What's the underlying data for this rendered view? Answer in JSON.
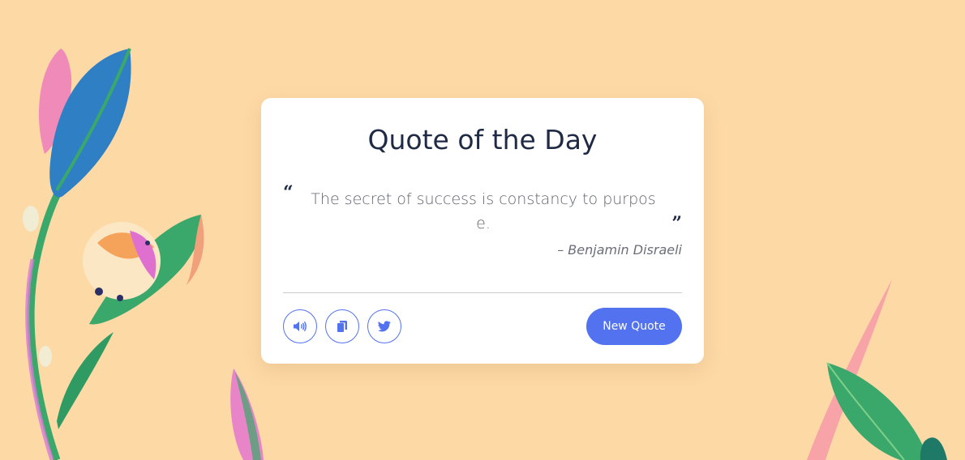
{
  "card": {
    "title": "Quote of the Day",
    "quote_text": "The secret of success is constancy to purpose.",
    "author": "– Benjamin Disraeli"
  },
  "actions": {
    "new_quote_label": "New Quote",
    "icons": [
      "speaker-icon",
      "copy-icon",
      "twitter-icon"
    ]
  },
  "colors": {
    "background": "#fdd9a6",
    "card": "#ffffff",
    "accent": "#5372f0",
    "title": "#1f2a44",
    "quote_text": "#5f6470"
  }
}
